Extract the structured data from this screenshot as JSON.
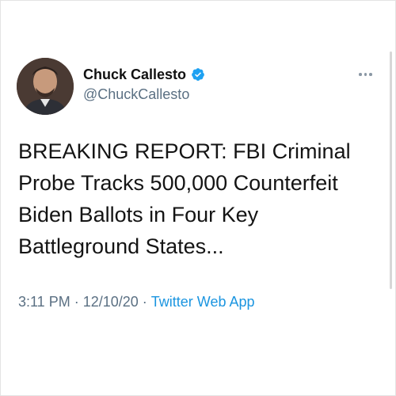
{
  "tweet": {
    "author": {
      "display_name": "Chuck Callesto",
      "handle": "@ChuckCallesto",
      "verified": true
    },
    "text": "BREAKING REPORT: FBI Criminal\nProbe Tracks 500,000 Counterfeit\nBiden Ballots in Four Key\nBattleground States...",
    "time": "3:11 PM",
    "separator": "·",
    "date": "12/10/20",
    "source": "Twitter Web App"
  },
  "icons": {
    "verified": "verified-badge-icon",
    "more": "more-options-icon"
  },
  "colors": {
    "accent": "#1b95e0",
    "secondary_text": "#5b7083",
    "primary_text": "#141414"
  }
}
